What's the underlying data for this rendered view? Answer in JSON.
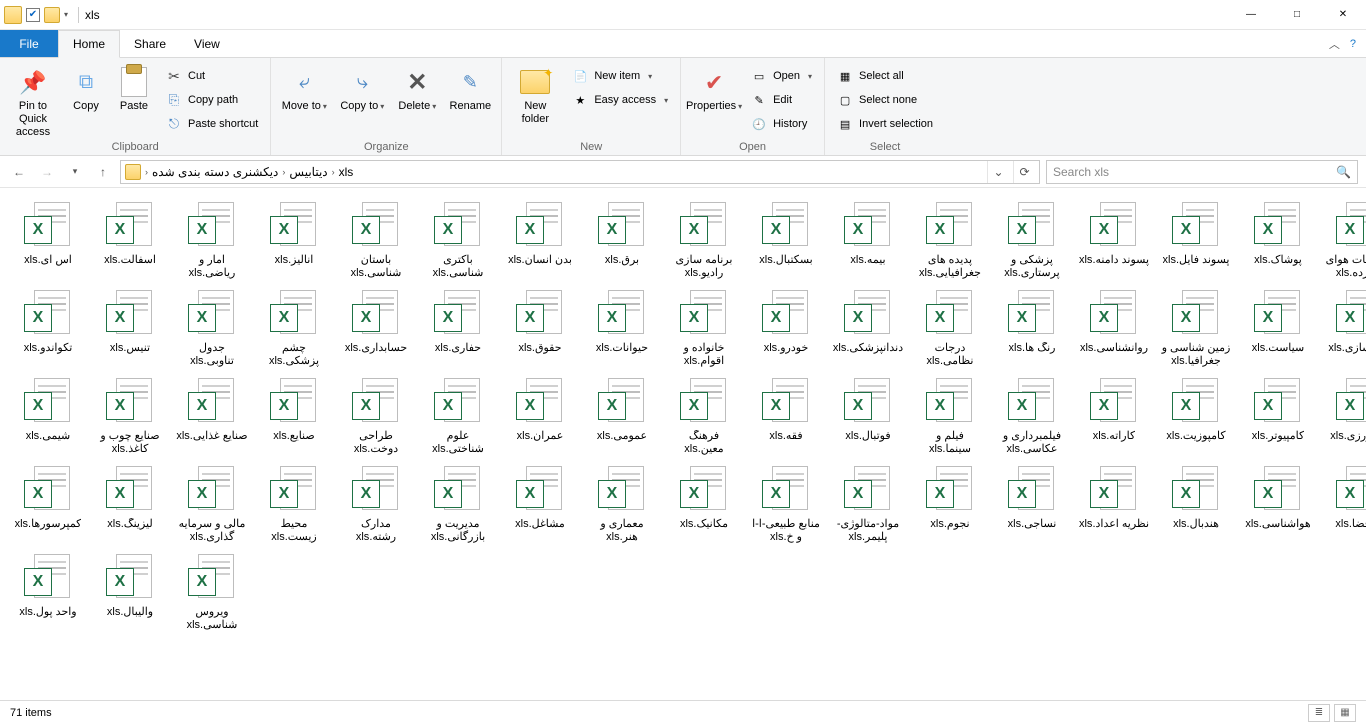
{
  "title": "xls",
  "qat": {
    "checked": true
  },
  "ribbonTabs": {
    "file": "File",
    "home": "Home",
    "share": "Share",
    "view": "View"
  },
  "ribbon": {
    "clipboard": {
      "label": "Clipboard",
      "pin": "Pin to Quick access",
      "copy": "Copy",
      "paste": "Paste",
      "cut": "Cut",
      "copyPath": "Copy path",
      "pasteShortcut": "Paste shortcut"
    },
    "organize": {
      "label": "Organize",
      "moveTo": "Move to",
      "copyTo": "Copy to",
      "delete": "Delete",
      "rename": "Rename"
    },
    "new": {
      "label": "New",
      "newFolder": "New folder",
      "newItem": "New item",
      "easyAccess": "Easy access"
    },
    "open": {
      "label": "Open",
      "properties": "Properties",
      "open": "Open",
      "edit": "Edit",
      "history": "History"
    },
    "select": {
      "label": "Select",
      "selectAll": "Select all",
      "selectNone": "Select none",
      "invert": "Invert selection"
    }
  },
  "breadcrumb": [
    "دیکشنری دسته بندی شده",
    "دیتابیس",
    "xls"
  ],
  "search": {
    "placeholder": "Search xls"
  },
  "files": [
    "اس آی.xls",
    "آسفالت.xls",
    "آمار و ریاضی.xls",
    "آنالیز.xls",
    "باستان شناسی.xls",
    "باکتری شناسی.xls",
    "بدن انسان.xls",
    "برق.xls",
    "برنامه سازی رادیو.xls",
    "بسکتبال.xls",
    "بیمه.xls",
    "پدیده های جغرافیایی.xls",
    "پزشکی و پرستاری.xls",
    "پسوند دامنه.xls",
    "پسوند فایل.xls",
    "پوشاک.xls",
    "تاسیسات هوای فشرده.xls",
    "تکواندو.xls",
    "تنیس.xls",
    "جدول تناوبی.xls",
    "چشم پزشکی.xls",
    "حسابداری.xls",
    "حفاری.xls",
    "حقوق.xls",
    "حیوانات.xls",
    "خانواده و اقوام.xls",
    "خودرو.xls",
    "دندانپزشکی.xls",
    "درجات نظامی.xls",
    "رنگ ها.xls",
    "روانشناسی.xls",
    "زمین شناسی و جغرافیا.xls",
    "سیاست.xls",
    "شهرسازی.xls",
    "شیمی.xls",
    "صنایع چوب و کاغذ.xls",
    "صنایع غذایی.xls",
    "صنایع.xls",
    "طراحی دوخت.xls",
    "علوم شناختی.xls",
    "عمران.xls",
    "عمومی.xls",
    "فرهنگ معین.xls",
    "فقه.xls",
    "فوتبال.xls",
    "فیلم و سینما.xls",
    "فیلمبرداری و عکاسی.xls",
    "کاراته.xls",
    "کامپوزیت.xls",
    "کامپیوتر.xls",
    "کشاورزی.xls",
    "کمپرسورها.xls",
    "لیزینگ.xls",
    "مالی و سرمایه گذاری.xls",
    "محیط زیست.xls",
    "مدارک رشته.xls",
    "مدیریت و بازرگانی.xls",
    "مشاغل.xls",
    "معماری و هنر.xls",
    "مکانیک.xls",
    "منابع طبیعی-آ-آ و خ.xls",
    "مواد-متالوژی-پلیمر.xls",
    "نجوم.xls",
    "نساجی.xls",
    "نظریه اعداد.xls",
    "هندبال.xls",
    "هواشناسی.xls",
    "هوافضا.xls",
    "واحد پول.xls",
    "والیبال.xls",
    "ویروس شناسی.xls"
  ],
  "status": {
    "items": "71 items"
  }
}
